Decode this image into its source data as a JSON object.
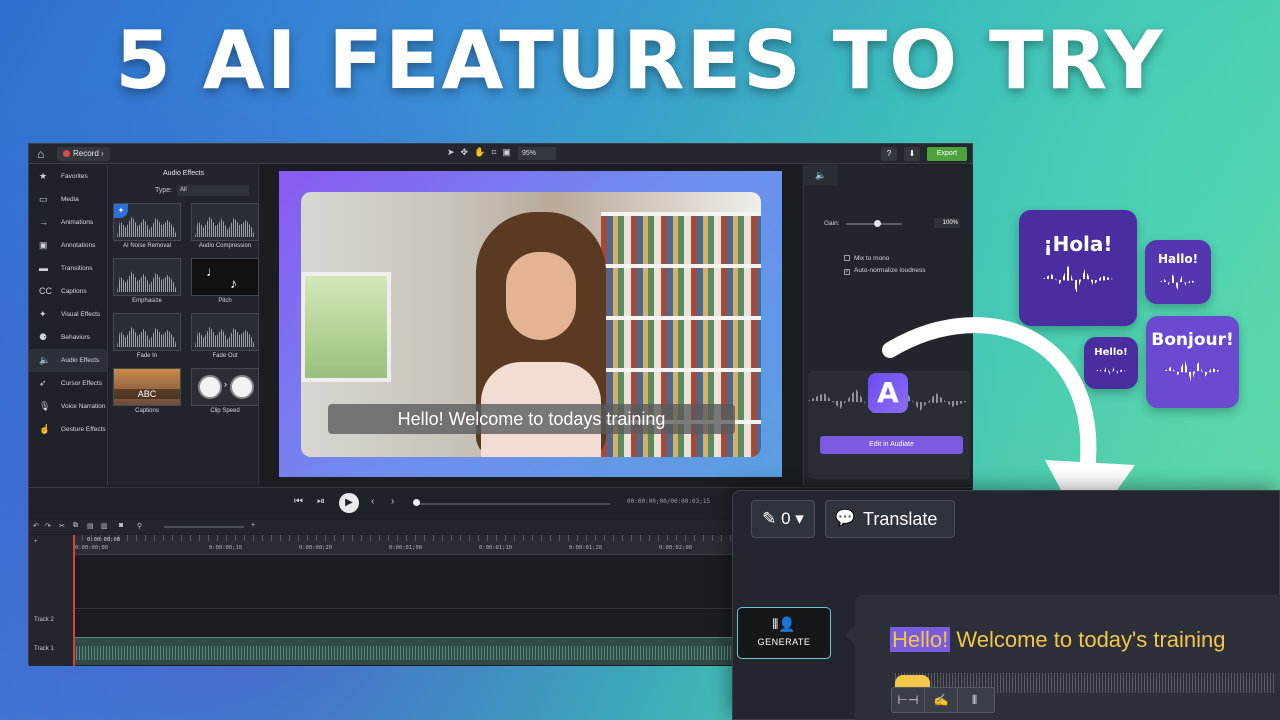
{
  "headline": "5 AI FEATURES TO TRY",
  "topbar": {
    "record_label": "Record",
    "zoom": "95%",
    "help": "?",
    "export_label": "Export"
  },
  "sidebar": {
    "items": [
      {
        "label": "Favorites",
        "icon": "star-icon"
      },
      {
        "label": "Media",
        "icon": "film-icon"
      },
      {
        "label": "Animations",
        "icon": "arrow-icon"
      },
      {
        "label": "Annotations",
        "icon": "annotation-icon"
      },
      {
        "label": "Transitions",
        "icon": "transition-icon"
      },
      {
        "label": "Captions",
        "icon": "cc-icon"
      },
      {
        "label": "Visual Effects",
        "icon": "wand-icon"
      },
      {
        "label": "Behaviors",
        "icon": "behavior-icon"
      },
      {
        "label": "Audio Effects",
        "icon": "speaker-icon"
      },
      {
        "label": "Cursor Effects",
        "icon": "cursor-icon"
      },
      {
        "label": "Voice Narration",
        "icon": "mic-icon"
      },
      {
        "label": "Gesture Effects",
        "icon": "hand-icon"
      }
    ],
    "active": "Audio Effects"
  },
  "effects_panel": {
    "title": "Audio Effects",
    "type_label": "Type:",
    "type_value": "All",
    "tiles": [
      {
        "label": "AI Noise Removal"
      },
      {
        "label": "Audio Compression"
      },
      {
        "label": "Emphasize"
      },
      {
        "label": "Pitch"
      },
      {
        "label": "Fade In"
      },
      {
        "label": "Fade Out"
      },
      {
        "label": "Captions",
        "thumb_text": "ABC"
      },
      {
        "label": "Clip Speed"
      }
    ]
  },
  "canvas": {
    "caption": "Hello! Welcome to todays training"
  },
  "properties": {
    "gain_label": "Gain:",
    "gain_value": "100%",
    "gain_level": 0.5,
    "mix_to_mono": "Mix to mono",
    "auto_normalize": "Auto-normalize loudness",
    "audiate_letter": "A",
    "edit_in_audiate": "Edit in Audiate"
  },
  "playback": {
    "time": "00:00:00;00/00:00:03;15"
  },
  "timeline": {
    "playhead_time": "0:00:00;00",
    "ticks": [
      "0:00:00;00",
      "0:00:00;10",
      "0:00:00;20",
      "0:00:01;00",
      "0:00:01;10",
      "0:00:01;20",
      "0:00:02;00",
      "0:00:02;10"
    ],
    "tracks": [
      "Track 2",
      "Track 1"
    ]
  },
  "audiate_panel": {
    "edit_count": "0",
    "translate_label": "Translate",
    "generate_label": "GENERATE",
    "transcript_highlight": "Hello!",
    "transcript_rest": " Welcome to today's training"
  },
  "languages": {
    "hola": "¡Hola!",
    "hallo": "Hallo!",
    "hello": "Hello!",
    "bonjour": "Bonjour!"
  }
}
